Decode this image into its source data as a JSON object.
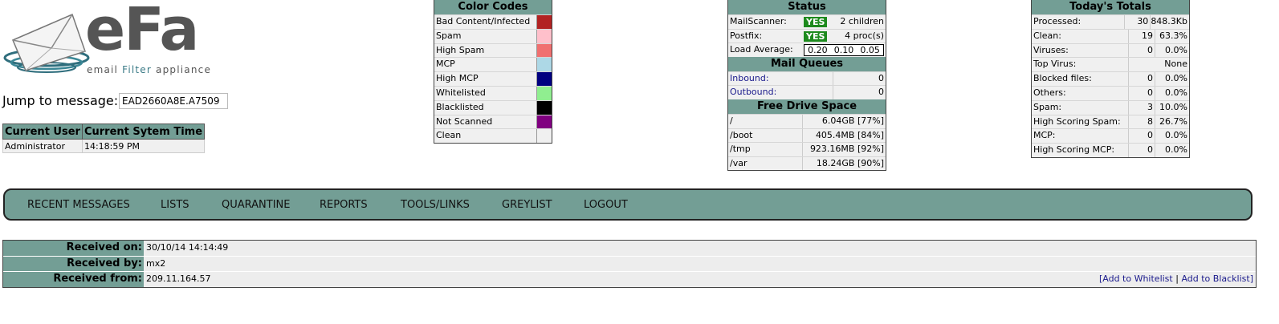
{
  "logo": {
    "main": "eFa",
    "tagline_pre": "email ",
    "tagline_highlight": "Filter",
    "tagline_post": " appliance"
  },
  "jump": {
    "label": "Jump to message:",
    "value": "EAD2660A8E.A7509"
  },
  "user_table": {
    "headers": [
      "Current User",
      "Current Sytem Time"
    ],
    "user": "Administrator",
    "time": "14:18:59 PM"
  },
  "color_codes": {
    "title": "Color Codes",
    "items": [
      {
        "label": "Bad Content/Infected",
        "color": "#b22222"
      },
      {
        "label": "Spam",
        "color": "#ffc0cb"
      },
      {
        "label": "High Spam",
        "color": "#f07070"
      },
      {
        "label": "MCP",
        "color": "#add8e6"
      },
      {
        "label": "High MCP",
        "color": "#000080"
      },
      {
        "label": "Whitelisted",
        "color": "#90ee90"
      },
      {
        "label": "Blacklisted",
        "color": "#000000"
      },
      {
        "label": "Not Scanned",
        "color": "#800080"
      },
      {
        "label": "Clean",
        "color": "#f0f0f0"
      }
    ]
  },
  "status": {
    "title": "Status",
    "mailscanner_label": "MailScanner:",
    "mailscanner_state": "YES",
    "mailscanner_info": "2 children",
    "postfix_label": "Postfix:",
    "postfix_state": "YES",
    "postfix_info": "4 proc(s)",
    "load_label": "Load Average:",
    "load_values": [
      "0.20",
      "0.10",
      "0.05"
    ]
  },
  "mail_queues": {
    "title": "Mail Queues",
    "inbound_label": "Inbound:",
    "inbound_value": "0",
    "outbound_label": "Outbound:",
    "outbound_value": "0"
  },
  "drive_space": {
    "title": "Free Drive Space",
    "rows": [
      {
        "mount": "/",
        "free": "6.04GB [77%]"
      },
      {
        "mount": "/boot",
        "free": "405.4MB [84%]"
      },
      {
        "mount": "/tmp",
        "free": "923.16MB [92%]"
      },
      {
        "mount": "/var",
        "free": "18.24GB [90%]"
      }
    ]
  },
  "totals": {
    "title": "Today's Totals",
    "rows": [
      {
        "label": "Processed:",
        "count": "30",
        "pct": "848.3Kb"
      },
      {
        "label": "Clean:",
        "count": "19",
        "pct": "63.3%"
      },
      {
        "label": "Viruses:",
        "count": "0",
        "pct": "0.0%"
      },
      {
        "label": "Top Virus:",
        "count": "",
        "pct": "None"
      },
      {
        "label": "Blocked files:",
        "count": "0",
        "pct": "0.0%"
      },
      {
        "label": "Others:",
        "count": "0",
        "pct": "0.0%"
      },
      {
        "label": "Spam:",
        "count": "3",
        "pct": "10.0%"
      },
      {
        "label": "High Scoring Spam:",
        "count": "8",
        "pct": "26.7%"
      },
      {
        "label": "MCP:",
        "count": "0",
        "pct": "0.0%"
      },
      {
        "label": "High Scoring MCP:",
        "count": "0",
        "pct": "0.0%"
      }
    ]
  },
  "nav": {
    "items": [
      "RECENT MESSAGES",
      "LISTS",
      "QUARANTINE",
      "REPORTS",
      "TOOLS/LINKS",
      "GREYLIST",
      "LOGOUT"
    ]
  },
  "details": {
    "received_on_label": "Received on:",
    "received_on_value": "30/10/14 14:14:49",
    "received_by_label": "Received by:",
    "received_by_value": "mx2",
    "received_from_label": "Received from:",
    "received_from_value": "209.11.164.57",
    "bracket_open": "[",
    "add_whitelist": "Add to Whitelist",
    "separator": "|",
    "add_blacklist": "Add to Blacklist",
    "bracket_close": "]"
  }
}
